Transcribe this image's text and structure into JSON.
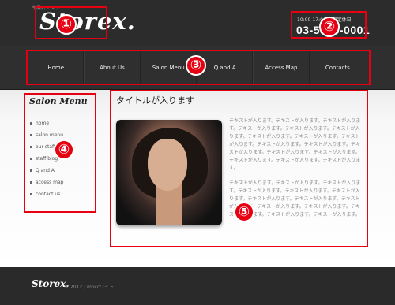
{
  "header": {
    "tagline": "所属名エステ",
    "logo": "Storex.",
    "hours": "10:00-17:00 土日定休日",
    "phone": "03-5555-0001"
  },
  "nav": {
    "items": [
      {
        "label": "Home"
      },
      {
        "label": "About Us"
      },
      {
        "label": "Salon Menu"
      },
      {
        "label": "Q and A"
      },
      {
        "label": "Access Map"
      },
      {
        "label": "Contacts"
      }
    ]
  },
  "sidebar": {
    "title": "Salon Menu",
    "items": [
      {
        "label": "home"
      },
      {
        "label": "salon menu"
      },
      {
        "label": "our staff"
      },
      {
        "label": "staff blog"
      },
      {
        "label": "Q and A"
      },
      {
        "label": "access map"
      },
      {
        "label": "contact us"
      }
    ]
  },
  "main": {
    "title": "タイトルが入ります",
    "paragraphs": [
      "テキストが入ります。テキストが入ります。テキストが入ります。テキストが入ります。テキストが入ります。テキストが入ります。テキストが入ります。テキストが入ります。テキストが入ります。テキストが入ります。テキストが入ります。テキストが入ります。テキストが入ります。テキストが入ります。テキストが入ります。テキストが入ります。テキストが入ります。",
      "テキストが入ります。テキストが入ります。テキストが入ります。テキストが入ります。テキストが入ります。テキストが入ります。テキストが入ります。テキストが入ります。テキストが入ります。テキストが入ります。テキストが入ります。テキストが入ります。テキストが入ります。テキストが入ります。"
    ]
  },
  "footer": {
    "logo": "Storex.",
    "copyright": "© 2012 | moccワイト"
  },
  "annotations": [
    "①",
    "②",
    "③",
    "④",
    "⑤"
  ],
  "colors": {
    "annotation": "#e60012",
    "header_bg": "#2c2c2c",
    "footer_bg": "#2a2a2a"
  }
}
